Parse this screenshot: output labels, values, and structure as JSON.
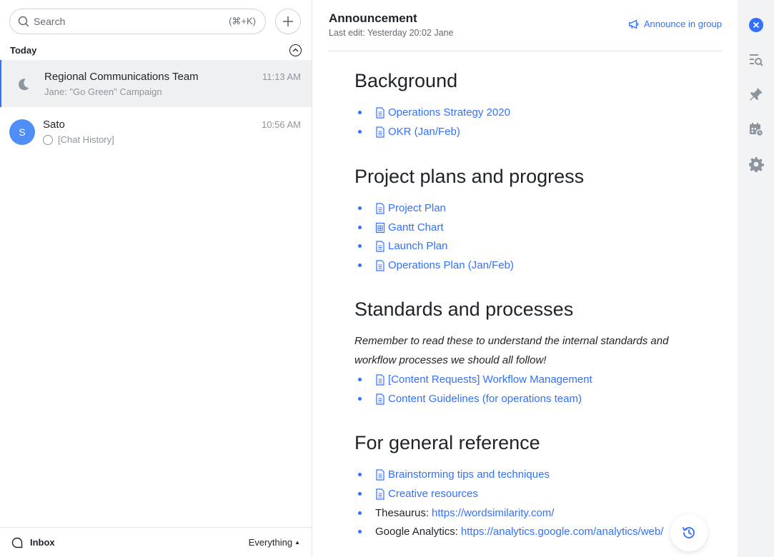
{
  "search": {
    "placeholder": "Search",
    "shortcut": "(⌘+K)"
  },
  "section": {
    "label": "Today"
  },
  "chats": [
    {
      "title": "Regional Communications Team",
      "time": "11:13 AM",
      "preview": "Jane: \"Go Green\" Campaign",
      "avatar_icon": "moon-icon"
    },
    {
      "title": "Sato",
      "time": "10:56 AM",
      "preview": "[Chat History]",
      "avatar_letter": "S",
      "avatar_color": "#4f8ef7"
    }
  ],
  "footer": {
    "inbox_label": "Inbox",
    "filter_label": "Everything"
  },
  "announcement": {
    "title": "Announcement",
    "last_edit": "Last edit: Yesterday 20:02 Jane",
    "announce_label": "Announce in group"
  },
  "doc": {
    "background": {
      "heading": "Background",
      "items": [
        "Operations Strategy 2020",
        "OKR (Jan/Feb)"
      ]
    },
    "plans": {
      "heading": "Project plans and progress",
      "items": [
        "Project Plan",
        "Gantt Chart",
        "Launch Plan",
        "Operations Plan (Jan/Feb)"
      ]
    },
    "standards": {
      "heading": "Standards and processes",
      "note": "Remember to read these to understand the internal standards and workflow processes we should all follow!",
      "items": [
        "[Content Requests] Workflow Management",
        "Content Guidelines (for operations team)"
      ]
    },
    "reference": {
      "heading": "For general reference",
      "items": [
        "Brainstorming tips and techniques",
        "Creative resources"
      ],
      "thesaurus_label": "Thesaurus:",
      "thesaurus_url": "https://wordsimilarity.com/",
      "analytics_label": "Google Analytics:",
      "analytics_url": "https://analytics.google.com/analytics/web/"
    }
  },
  "colors": {
    "accent": "#3370ff",
    "text": "#1f2329",
    "muted": "#8f959e",
    "rail_bg": "#f2f3f5"
  }
}
